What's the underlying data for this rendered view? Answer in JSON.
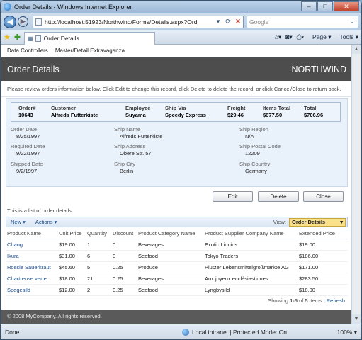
{
  "window": {
    "title": "Order Details - Windows Internet Explorer"
  },
  "address": {
    "url": "http://localhost:51923/Northwind/Forms/Details.aspx?Ord",
    "search_placeholder": "Google"
  },
  "tab": {
    "label": "Order Details"
  },
  "commands": {
    "page": "Page",
    "tools": "Tools"
  },
  "menu": {
    "items": [
      "Data Controllers",
      "Master/Detail Extravaganza"
    ]
  },
  "header": {
    "title": "Order Details",
    "brand": "NORTHWIND"
  },
  "instructions": "Please review orders information below. Click Edit to change this record, click Delete to delete the record, or click Cancel/Close to return back.",
  "summary": {
    "order_label": "Order#",
    "order": "10643",
    "customer_label": "Customer",
    "customer": "Alfreds Futterkiste",
    "employee_label": "Employee",
    "employee": "Suyama",
    "shipvia_label": "Ship Via",
    "shipvia": "Speedy Express",
    "freight_label": "Freight",
    "freight": "$29.46",
    "items_total_label": "Items Total",
    "items_total": "$677.50",
    "total_label": "Total",
    "total": "$706.96"
  },
  "fields": {
    "order_date": {
      "label": "Order Date",
      "value": "8/25/1997"
    },
    "required_date": {
      "label": "Required Date",
      "value": "9/22/1997"
    },
    "shipped_date": {
      "label": "Shipped Date",
      "value": "9/2/1997"
    },
    "ship_name": {
      "label": "Ship Name",
      "value": "Alfreds Futterkiste"
    },
    "ship_address": {
      "label": "Ship Address",
      "value": "Obere Str. 57"
    },
    "ship_city": {
      "label": "Ship City",
      "value": "Berlin"
    },
    "ship_region": {
      "label": "Ship Region",
      "value": "N/A"
    },
    "ship_postal": {
      "label": "Ship Postal Code",
      "value": "12209"
    },
    "ship_country": {
      "label": "Ship Country",
      "value": "Germany"
    }
  },
  "buttons": {
    "edit": "Edit",
    "delete": "Delete",
    "close": "Close"
  },
  "list": {
    "note": "This is a list of order details.",
    "new": "New",
    "actions": "Actions",
    "view_label": "View:",
    "view_value": "Order Details",
    "columns": [
      "Product Name",
      "Unit Price",
      "Quantity",
      "Discount",
      "Product Category Name",
      "Product Supplier Company Name",
      "Extended Price"
    ],
    "rows": [
      [
        "Chang",
        "$19.00",
        "1",
        "0",
        "Beverages",
        "Exotic Liquids",
        "$19.00"
      ],
      [
        "Ikura",
        "$31.00",
        "6",
        "0",
        "Seafood",
        "Tokyo Traders",
        "$186.00"
      ],
      [
        "Rössle Sauerkraut",
        "$45.60",
        "5",
        "0.25",
        "Produce",
        "Plutzer Lebensmittelgroßmärkte AG",
        "$171.00"
      ],
      [
        "Chartreuse verte",
        "$18.00",
        "21",
        "0.25",
        "Beverages",
        "Aux joyeux ecclésiastiques",
        "$283.50"
      ],
      [
        "Spegesild",
        "$12.00",
        "2",
        "0.25",
        "Seafood",
        "Lyngbysild",
        "$18.00"
      ]
    ],
    "pager_showing": "Showing",
    "pager_range": "1-5",
    "pager_of": "of",
    "pager_total": "5",
    "pager_items": "items |",
    "refresh": "Refresh"
  },
  "footer": "© 2008 MyCompany. All rights reserved.",
  "status": {
    "text": "Done",
    "zone": "Local intranet | Protected Mode: On",
    "zoom": "100%"
  },
  "icons": [
    "ie-logo",
    "back-arrow-icon",
    "forward-arrow-icon",
    "refresh-icon",
    "stop-icon",
    "search-icon",
    "favorites-star-icon",
    "add-favorites-icon",
    "home-icon",
    "feeds-icon",
    "print-icon",
    "globe-icon"
  ]
}
